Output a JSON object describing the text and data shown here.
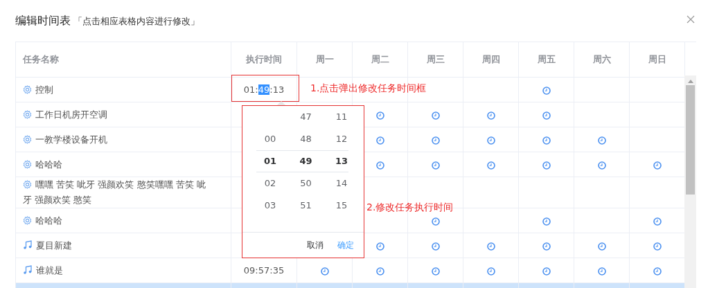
{
  "dialog": {
    "title": "编辑时间表",
    "subtitle": "「点击相应表格内容进行修改」"
  },
  "table": {
    "columns": [
      "任务名称",
      "执行时间",
      "周一",
      "周二",
      "周三",
      "周四",
      "周五",
      "周六",
      "周日"
    ],
    "rows": [
      {
        "kind": "gear",
        "name": "控制",
        "time_parts": [
          {
            "text": "01:",
            "selected": false
          },
          {
            "text": "49",
            "selected": true
          },
          {
            "text": ":13",
            "selected": false
          }
        ],
        "days": [
          false,
          false,
          false,
          false,
          true,
          false,
          false
        ],
        "selected": false
      },
      {
        "kind": "gear",
        "name": "工作日机房开空调",
        "days": [
          true,
          true,
          true,
          true,
          false,
          false
        ],
        "selected": false
      },
      {
        "kind": "gear",
        "name": "一教学楼设备开机",
        "days": [
          true,
          true,
          true,
          true,
          true,
          false
        ],
        "selected": false
      },
      {
        "kind": "gear",
        "name": "哈哈哈",
        "days": [
          true,
          true,
          true,
          true,
          true,
          true
        ],
        "selected": false
      },
      {
        "kind": "gear",
        "name": "嘿嘿 苦笑 呲牙 强颜欢笑 憨笑嘿嘿 苦笑 呲牙 强颜欢笑 憨笑",
        "days": [
          false,
          false,
          false,
          false,
          false,
          false
        ],
        "selected": false
      },
      {
        "kind": "gear",
        "name": "哈哈哈",
        "days": [
          false,
          true,
          false,
          true,
          false,
          true
        ],
        "selected": false
      },
      {
        "kind": "note",
        "name": "夏目新建",
        "days": [
          true,
          true,
          true,
          true,
          true,
          true
        ],
        "selected": false
      },
      {
        "kind": "note",
        "name": "谁就是",
        "time_parts": [
          {
            "text": "09:57:35",
            "selected": false
          }
        ],
        "days": [
          true,
          true,
          true,
          true,
          true,
          true,
          true
        ],
        "selected": false
      },
      {
        "selected": true
      }
    ]
  },
  "time_picker": {
    "columns": [
      [
        {
          "text": "00",
          "selected": false
        },
        {
          "text": "01",
          "selected": true
        },
        {
          "text": "02",
          "selected": false
        },
        {
          "text": "03",
          "selected": false
        }
      ],
      [
        {
          "text": "47",
          "selected": false
        },
        {
          "text": "48",
          "selected": false
        },
        {
          "text": "49",
          "selected": true
        },
        {
          "text": "50",
          "selected": false
        },
        {
          "text": "51",
          "selected": false
        }
      ],
      [
        {
          "text": "11",
          "selected": false
        },
        {
          "text": "12",
          "selected": false
        },
        {
          "text": "13",
          "selected": true
        },
        {
          "text": "14",
          "selected": false
        },
        {
          "text": "15",
          "selected": false
        }
      ]
    ],
    "cancel": "取消",
    "confirm": "确定"
  },
  "annotations": [
    "1.点击弹出修改任务时间框",
    "2.修改任务执行时间"
  ]
}
